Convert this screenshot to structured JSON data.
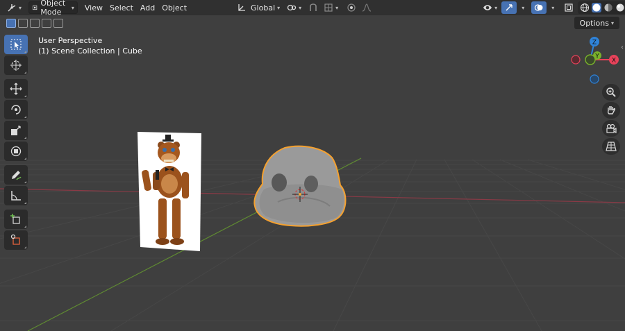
{
  "header": {
    "mode_label": "Object Mode",
    "menus": [
      "View",
      "Select",
      "Add",
      "Object"
    ],
    "orientation_label": "Global"
  },
  "subheader": {
    "options_label": "Options"
  },
  "viewport": {
    "perspective_label": "User Perspective",
    "collection_label": "(1) Scene Collection | Cube"
  },
  "gizmo": {
    "z_label": "Z",
    "y_label": "Y",
    "x_label": "X"
  },
  "colors": {
    "accent": "#4772b3",
    "selection_outline": "#f5a12f",
    "x_axis": "#e8425a",
    "y_axis": "#7ab32b",
    "z_axis": "#2f83d9"
  },
  "icons": {
    "toolbar": [
      "select-box-icon",
      "cursor-icon",
      "move-icon",
      "rotate-icon",
      "scale-icon",
      "transform-icon",
      "annotate-icon",
      "measure-icon",
      "add-cube-icon",
      "edit-cube-icon"
    ],
    "nav": [
      "zoom-icon",
      "hand-icon",
      "camera-icon",
      "ortho-grid-icon"
    ]
  }
}
